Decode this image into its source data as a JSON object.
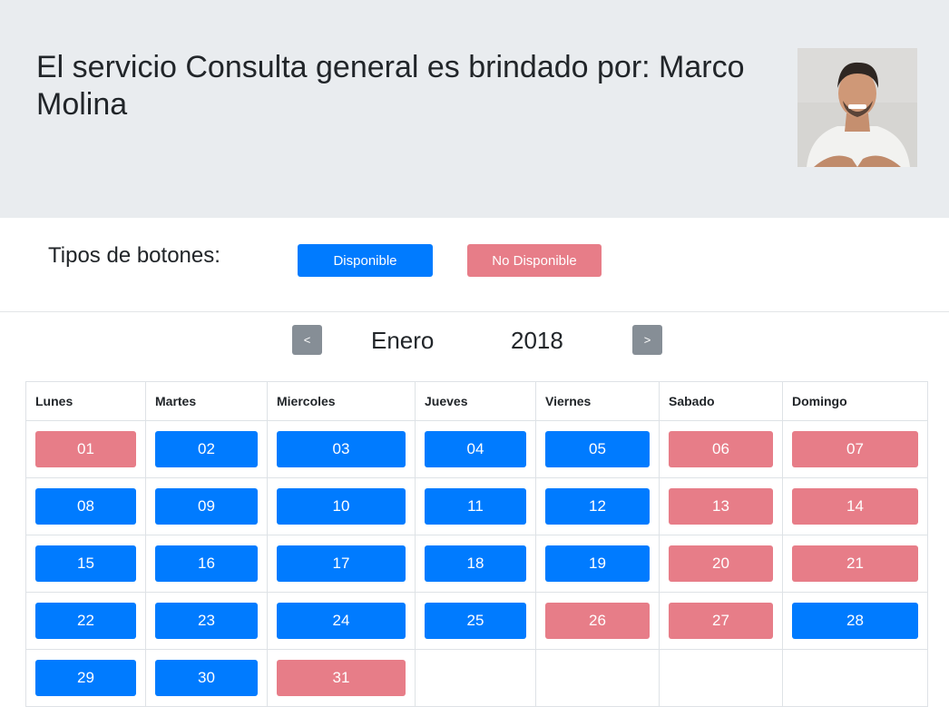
{
  "header": {
    "title": "El servicio Consulta general es brindado por: Marco Molina",
    "avatar_alt": "Marco Molina"
  },
  "legend": {
    "label": "Tipos de botones:",
    "available": "Disponible",
    "unavailable": "No Disponible"
  },
  "calendar": {
    "prev": "<",
    "next": ">",
    "month": "Enero",
    "year": "2018",
    "weekdays": [
      "Lunes",
      "Martes",
      "Miercoles",
      "Jueves",
      "Viernes",
      "Sabado",
      "Domingo"
    ],
    "weeks": [
      [
        {
          "day": "01",
          "status": "unavailable"
        },
        {
          "day": "02",
          "status": "available"
        },
        {
          "day": "03",
          "status": "available"
        },
        {
          "day": "04",
          "status": "available"
        },
        {
          "day": "05",
          "status": "available"
        },
        {
          "day": "06",
          "status": "unavailable"
        },
        {
          "day": "07",
          "status": "unavailable"
        }
      ],
      [
        {
          "day": "08",
          "status": "available"
        },
        {
          "day": "09",
          "status": "available"
        },
        {
          "day": "10",
          "status": "available"
        },
        {
          "day": "11",
          "status": "available"
        },
        {
          "day": "12",
          "status": "available"
        },
        {
          "day": "13",
          "status": "unavailable"
        },
        {
          "day": "14",
          "status": "unavailable"
        }
      ],
      [
        {
          "day": "15",
          "status": "available"
        },
        {
          "day": "16",
          "status": "available"
        },
        {
          "day": "17",
          "status": "available"
        },
        {
          "day": "18",
          "status": "available"
        },
        {
          "day": "19",
          "status": "available"
        },
        {
          "day": "20",
          "status": "unavailable"
        },
        {
          "day": "21",
          "status": "unavailable"
        }
      ],
      [
        {
          "day": "22",
          "status": "available"
        },
        {
          "day": "23",
          "status": "available"
        },
        {
          "day": "24",
          "status": "available"
        },
        {
          "day": "25",
          "status": "available"
        },
        {
          "day": "26",
          "status": "unavailable"
        },
        {
          "day": "27",
          "status": "unavailable"
        },
        {
          "day": "28",
          "status": "available"
        }
      ],
      [
        {
          "day": "29",
          "status": "available"
        },
        {
          "day": "30",
          "status": "available"
        },
        {
          "day": "31",
          "status": "unavailable"
        },
        null,
        null,
        null,
        null
      ]
    ]
  },
  "colors": {
    "available": "#007bff",
    "unavailable": "#e77d88",
    "nav": "#868e96",
    "hero_bg": "#e9ecef"
  }
}
